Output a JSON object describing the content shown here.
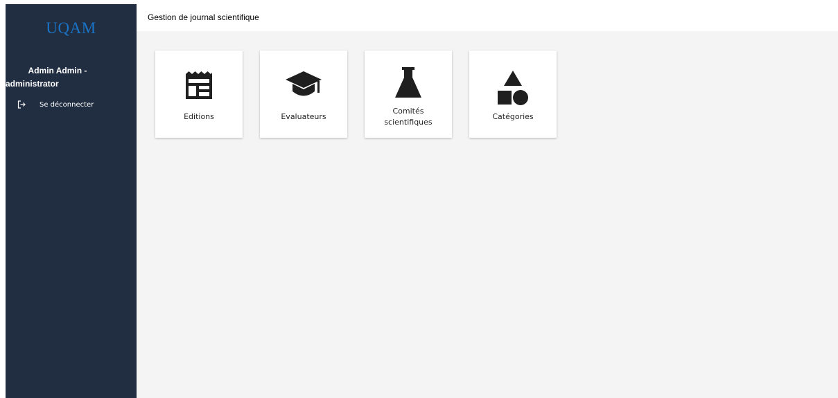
{
  "sidebar": {
    "logo": "UQAM",
    "user_line1": "Admin Admin -",
    "user_line2": "administrator",
    "logout_label": "Se déconnecter",
    "logout_icon": "logout-icon"
  },
  "header": {
    "title": "Gestion de journal scientifique"
  },
  "tiles": [
    {
      "label": "Editions",
      "icon": "newspaper-icon"
    },
    {
      "label": "Evaluateurs",
      "icon": "graduation-cap-icon"
    },
    {
      "label_line1": "Comités",
      "label_line2": "scientifiques",
      "icon": "flask-icon"
    },
    {
      "label": "Catégories",
      "icon": "shapes-icon"
    }
  ],
  "colors": {
    "sidebar_bg": "#212e42",
    "logo": "#1a73c4",
    "main_bg": "#f4f4f4",
    "icon": "#1f1f1f"
  }
}
